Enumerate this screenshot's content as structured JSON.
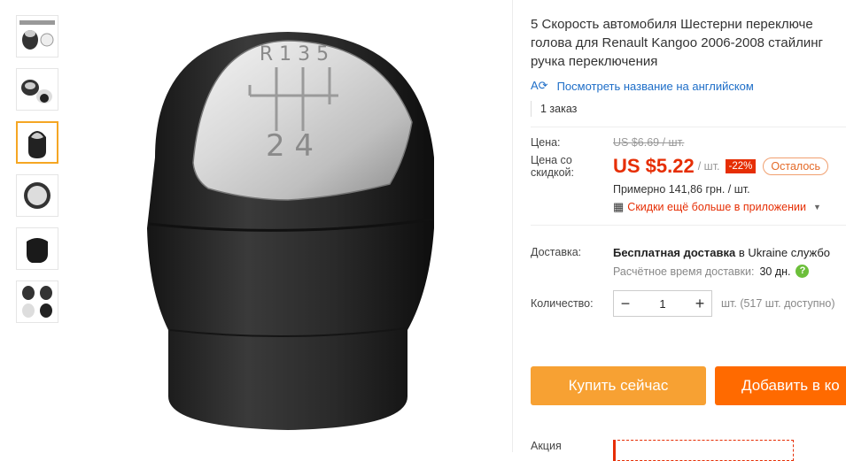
{
  "product": {
    "title_line1": "5 Скорость автомобиля Шестерни переключе",
    "title_line2": "голова для Renault Kangoo 2006-2008 стайлинг",
    "title_line3": "ручка переключения",
    "translate_link": "Посмотреть название на английском",
    "orders": "1 заказ"
  },
  "price": {
    "label": "Цена:",
    "old": "US $6.69 / шт.",
    "discount_label_1": "Цена со",
    "discount_label_2": "скидкой:",
    "new": "US $5.22",
    "unit": "/ шт.",
    "discount": "-22%",
    "left_badge": "Осталось",
    "approx": "Примерно 141,86 грн. / шт.",
    "app_promo": "Скидки ещё больше в приложении"
  },
  "shipping": {
    "label": "Доставка:",
    "value_bold": "Бесплатная доставка",
    "value_rest": " в Ukraine службо",
    "est_label": "Расчётное время доставки:",
    "est_days": "30 дн."
  },
  "quantity": {
    "label": "Количество:",
    "value": "1",
    "minus": "−",
    "plus": "+",
    "available": "шт. (517 шт. доступно)"
  },
  "buttons": {
    "buy": "Купить сейчас",
    "cart": "Добавить в ко"
  },
  "promo": {
    "label": "Акция"
  },
  "knob_numbers": {
    "top": "R 1 3 5",
    "bottom": "2 4"
  },
  "colors": {
    "accent": "#e62e04",
    "buy": "#f7a133",
    "cart": "#ff6a00",
    "link": "#1e6ec8"
  }
}
